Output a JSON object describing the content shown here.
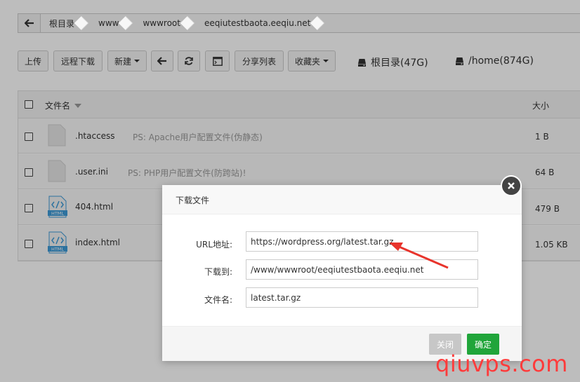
{
  "breadcrumb": {
    "items": [
      "根目录",
      "www",
      "wwwroot",
      "eeqiutestbaota.eeqiu.net"
    ]
  },
  "toolbar": {
    "upload": "上传",
    "remote_download": "远程下载",
    "new": "新建",
    "share_list": "分享列表",
    "favorites": "收藏夹",
    "disks": [
      {
        "label": "根目录(47G)"
      },
      {
        "label": "/home(874G)"
      }
    ]
  },
  "table": {
    "col_name": "文件名",
    "col_size": "大小",
    "rows": [
      {
        "name": ".htaccess",
        "note": "PS: Apache用户配置文件(伪静态)",
        "size": "1 B",
        "icon": "file-icon"
      },
      {
        "name": ".user.ini",
        "note": "PS: PHP用户配置文件(防跨站)!",
        "size": "64 B",
        "icon": "file-icon"
      },
      {
        "name": "404.html",
        "note": "",
        "size": "479 B",
        "icon": "html-file-icon"
      },
      {
        "name": "index.html",
        "note": "",
        "size": "1.05 KB",
        "icon": "html-file-icon"
      }
    ],
    "html_badge": "HTML"
  },
  "dialog": {
    "title": "下载文件",
    "url_label": "URL地址:",
    "url_value": "https://wordpress.org/latest.tar.gz",
    "dest_label": "下载到:",
    "dest_value": "/www/wwwroot/eeqiutestbaota.eeqiu.net",
    "filename_label": "文件名:",
    "filename_value": "latest.tar.gz",
    "close_button": "关闭",
    "confirm_button": "确定"
  },
  "watermark": "qiuvps.com",
  "colors": {
    "confirm": "#20a53a",
    "close_btn": "#c7c7c7",
    "arrow": "#e8342c",
    "html_icon": "#3d9ad7"
  }
}
